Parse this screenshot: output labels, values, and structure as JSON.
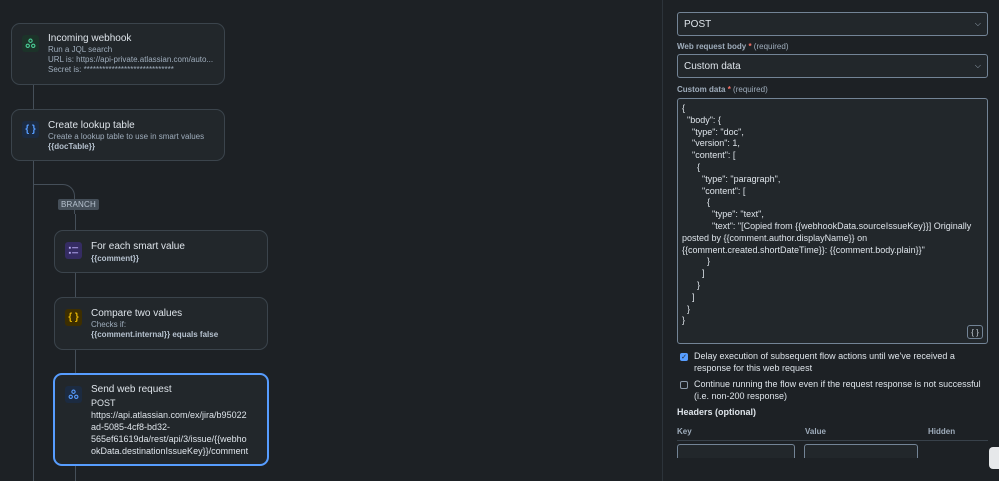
{
  "flow": {
    "branch_label": "BRANCH",
    "trigger": {
      "title": "Incoming webhook",
      "lines": [
        "Run a JQL search",
        "URL is: https://api-private.atlassian.com/auto...",
        "Secret is: *****************************"
      ]
    },
    "lookup": {
      "title": "Create lookup table",
      "line1": "Create a lookup table to use in smart values",
      "line2": "{{docTable}}"
    },
    "foreach": {
      "title": "For each smart value",
      "line1": "{{comment}}"
    },
    "compare": {
      "title": "Compare two values",
      "line1": "Checks if:",
      "line2": "{{comment.internal}} equals false"
    },
    "webreq": {
      "title": "Send web request",
      "lines": [
        "POST",
        "https://api.atlassian.com/ex/jira/b95022",
        "ad-5085-4cf8-bd32-",
        "565ef61619da/rest/api/3/issue/{{webho",
        "okData.destinationIssueKey}}/comment"
      ]
    }
  },
  "panel": {
    "method": {
      "value": "POST"
    },
    "body_label": {
      "text": "Web request body",
      "req": "*",
      "note": "(required)"
    },
    "body_select": {
      "value": "Custom data"
    },
    "custom_label": {
      "text": "Custom data",
      "req": "*",
      "note": "(required)"
    },
    "code_lines": [
      "{",
      "  \"body\": {",
      "    \"type\": \"doc\",",
      "    \"version\": 1,",
      "    \"content\": [",
      "      {",
      "        \"type\": \"paragraph\",",
      "        \"content\": [",
      "          {",
      "            \"type\": \"text\",",
      "            \"text\": \"[Copied from {{webhookData.sourceIssueKey}}] Originally posted by {{comment.author.displayName}} on {{comment.created.shortDateTime}}: {{comment.body.plain}}\"",
      "          }",
      "        ]",
      "      }",
      "    ]",
      "  }",
      "}"
    ],
    "json_button": "{ }",
    "delay_checkbox": {
      "checked": true,
      "label": "Delay execution of subsequent flow actions until we've received a response for this web request"
    },
    "continue_checkbox": {
      "checked": false,
      "label": "Continue running the flow even if the request response is not successful (i.e. non-200 response)"
    },
    "headers_title": "Headers (optional)",
    "headers_cols": {
      "key": "Key",
      "value": "Value",
      "hidden": "Hidden"
    }
  },
  "colors": {
    "accent": "#579dff",
    "background": "#1d2125",
    "card": "#22272b"
  },
  "icons": {
    "trigger": "webhook-icon",
    "lookup": "braces-icon",
    "foreach": "list-icon",
    "compare": "braces-icon",
    "webreq": "webhook-icon"
  }
}
